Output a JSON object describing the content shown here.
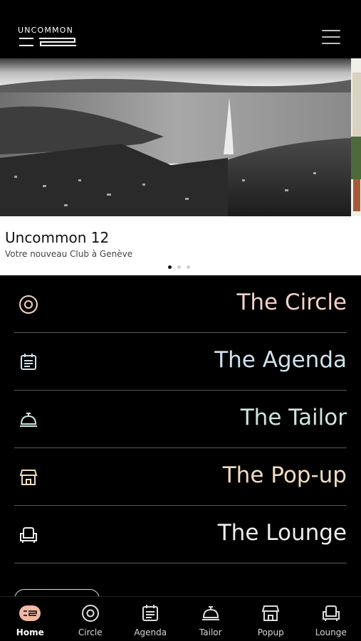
{
  "header": {
    "brand_name": "UNCOMMON",
    "brand_number": "12",
    "menu_icon": "hamburger-menu-icon"
  },
  "carousel": {
    "slides_count": 3,
    "active_slide": 1,
    "title": "Uncommon 12",
    "subtitle": "Votre nouveau Club à Genève"
  },
  "menu": {
    "items": [
      {
        "label": "The Circle",
        "icon": "circle-target-icon",
        "color": "#f2d2c6"
      },
      {
        "label": "The Agenda",
        "icon": "calendar-list-icon",
        "color": "#cfe0ea"
      },
      {
        "label": "The Tailor",
        "icon": "service-bell-icon",
        "color": "#cde6dc"
      },
      {
        "label": "The Pop-up",
        "icon": "storefront-icon",
        "color": "#f1dcc0"
      },
      {
        "label": "The Lounge",
        "icon": "armchair-icon",
        "color": "#ececec"
      }
    ]
  },
  "bottom_nav": {
    "active": "Home",
    "items": [
      {
        "label": "Home",
        "icon": "logo-12-badge-icon"
      },
      {
        "label": "Circle",
        "icon": "circle-target-icon"
      },
      {
        "label": "Agenda",
        "icon": "calendar-list-icon"
      },
      {
        "label": "Tailor",
        "icon": "service-bell-icon"
      },
      {
        "label": "Popup",
        "icon": "storefront-icon"
      },
      {
        "label": "Lounge",
        "icon": "armchair-icon"
      }
    ]
  },
  "colors": {
    "background": "#000000",
    "home_badge": "#f2b8a6",
    "divider": "#5a5a5a"
  }
}
